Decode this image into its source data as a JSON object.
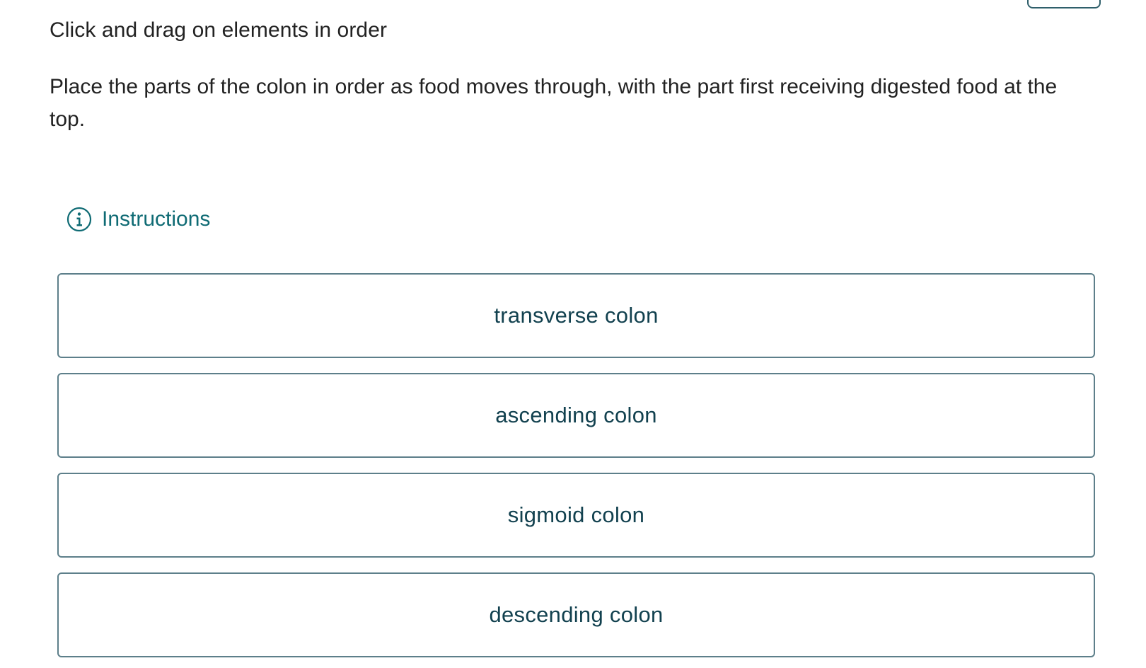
{
  "header": {
    "prompt_type": "Click and drag on elements in order"
  },
  "question": {
    "text": "Place the parts of the colon in order as food moves through, with the part first receiving digested food at the top."
  },
  "instructions": {
    "label": "Instructions",
    "icon": "info-icon"
  },
  "items": [
    {
      "label": "transverse colon"
    },
    {
      "label": "ascending colon"
    },
    {
      "label": "sigmoid colon"
    },
    {
      "label": "descending colon"
    }
  ],
  "colors": {
    "accent": "#0f6b74",
    "item_text": "#12414f",
    "item_border": "#5d7f8a",
    "body_text": "#222222"
  }
}
